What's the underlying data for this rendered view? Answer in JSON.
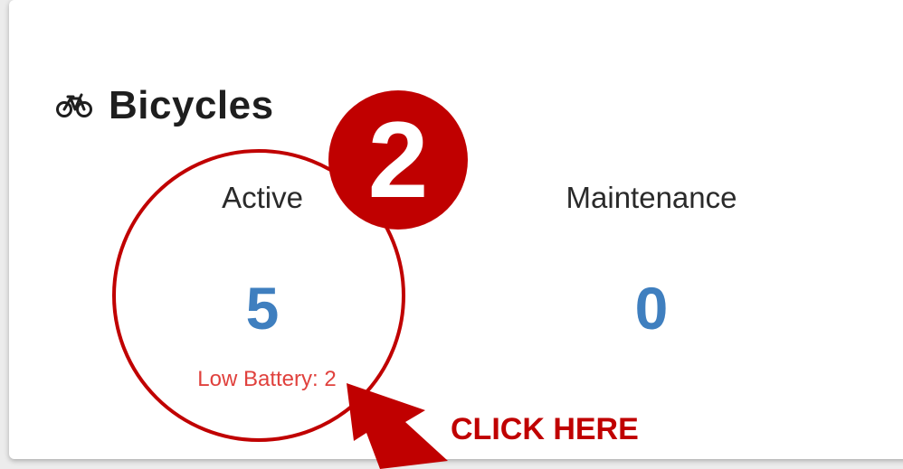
{
  "card": {
    "title": "Bicycles",
    "icon": "bicycle-icon"
  },
  "stats": {
    "active": {
      "label": "Active",
      "value": "5",
      "low_battery": "Low Battery: 2"
    },
    "maintenance": {
      "label": "Maintenance",
      "value": "0"
    }
  },
  "annotation": {
    "step_number": "2",
    "call_to_action": "CLICK HERE",
    "highlight_color": "#c00000"
  },
  "colors": {
    "value": "#3f7fbf",
    "warning": "#e0413d"
  }
}
